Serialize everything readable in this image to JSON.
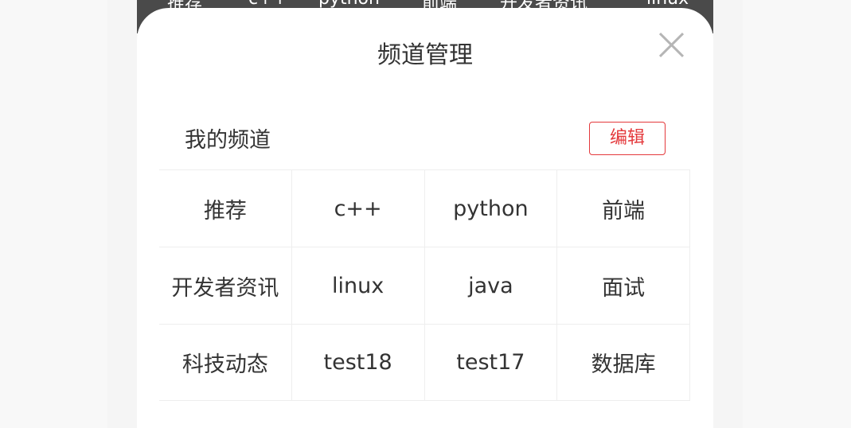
{
  "background_nav": {
    "items": [
      "推荐",
      "c++",
      "python",
      "前端",
      "开发者资讯",
      "linux"
    ]
  },
  "dialog": {
    "title": "频道管理",
    "close_icon": "close-icon",
    "my_channels_label": "我的频道",
    "edit_label": "编辑"
  },
  "channels": [
    "推荐",
    "c++",
    "python",
    "前端",
    "开发者资讯",
    "linux",
    "java",
    "面试",
    "科技动态",
    "test18",
    "test17",
    "数据库"
  ],
  "colors": {
    "accent": "#e4393c",
    "text": "#333333",
    "nav_bg": "#4a4a4a",
    "side_bg": "#f8f8f8"
  }
}
